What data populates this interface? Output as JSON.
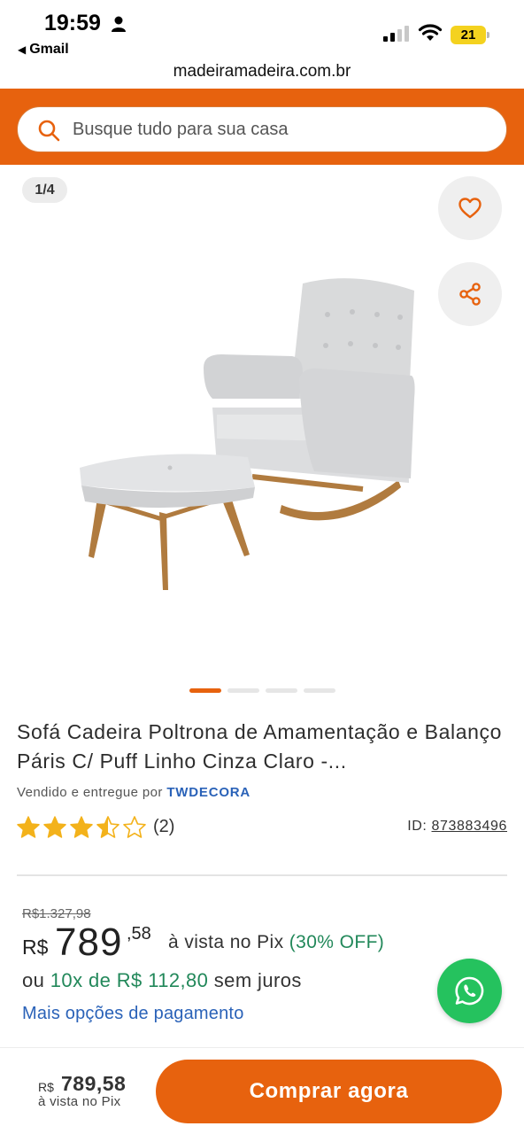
{
  "status_bar": {
    "time": "19:59",
    "back_app": "Gmail",
    "back_arrow": "◀",
    "battery": "21",
    "url": "madeiramadeira.com.br"
  },
  "search": {
    "placeholder": "Busque tudo para sua casa"
  },
  "gallery": {
    "counter": "1/4",
    "current_index": 1,
    "total": 4
  },
  "product": {
    "title": "Sofá Cadeira Poltrona de Amamentação e Balanço Páris C/ Puff Linho Cinza Claro -...",
    "seller_prefix": "Vendido e entregue por",
    "seller_name": "TWDECORA",
    "rating": 3.5,
    "reviews": "(2)",
    "id_label": "ID:",
    "id_value": "873883496"
  },
  "price": {
    "old_price": "R$1.327,98",
    "currency": "R$",
    "integer": "789",
    "cents": ",58",
    "pix_label": "à vista no Pix",
    "pix_discount": "(30% OFF)",
    "installment_prefix": "ou",
    "installment_value": "10x de R$ 112,80",
    "installment_suffix": "sem juros",
    "more_options": "Mais opções de pagamento"
  },
  "bottom_bar": {
    "currency": "R$",
    "price": "789,58",
    "pix_label": "à vista no Pix",
    "buy_label": "Comprar agora"
  },
  "colors": {
    "brand_orange": "#e7620e",
    "pix_green": "#22885a",
    "link_blue": "#2a62b8",
    "star_gold": "#f3b21b",
    "whatsapp_green": "#25c25e"
  },
  "icons": {
    "search": "search-icon",
    "favorite": "heart-icon",
    "share": "share-icon",
    "whatsapp": "whatsapp-icon"
  }
}
